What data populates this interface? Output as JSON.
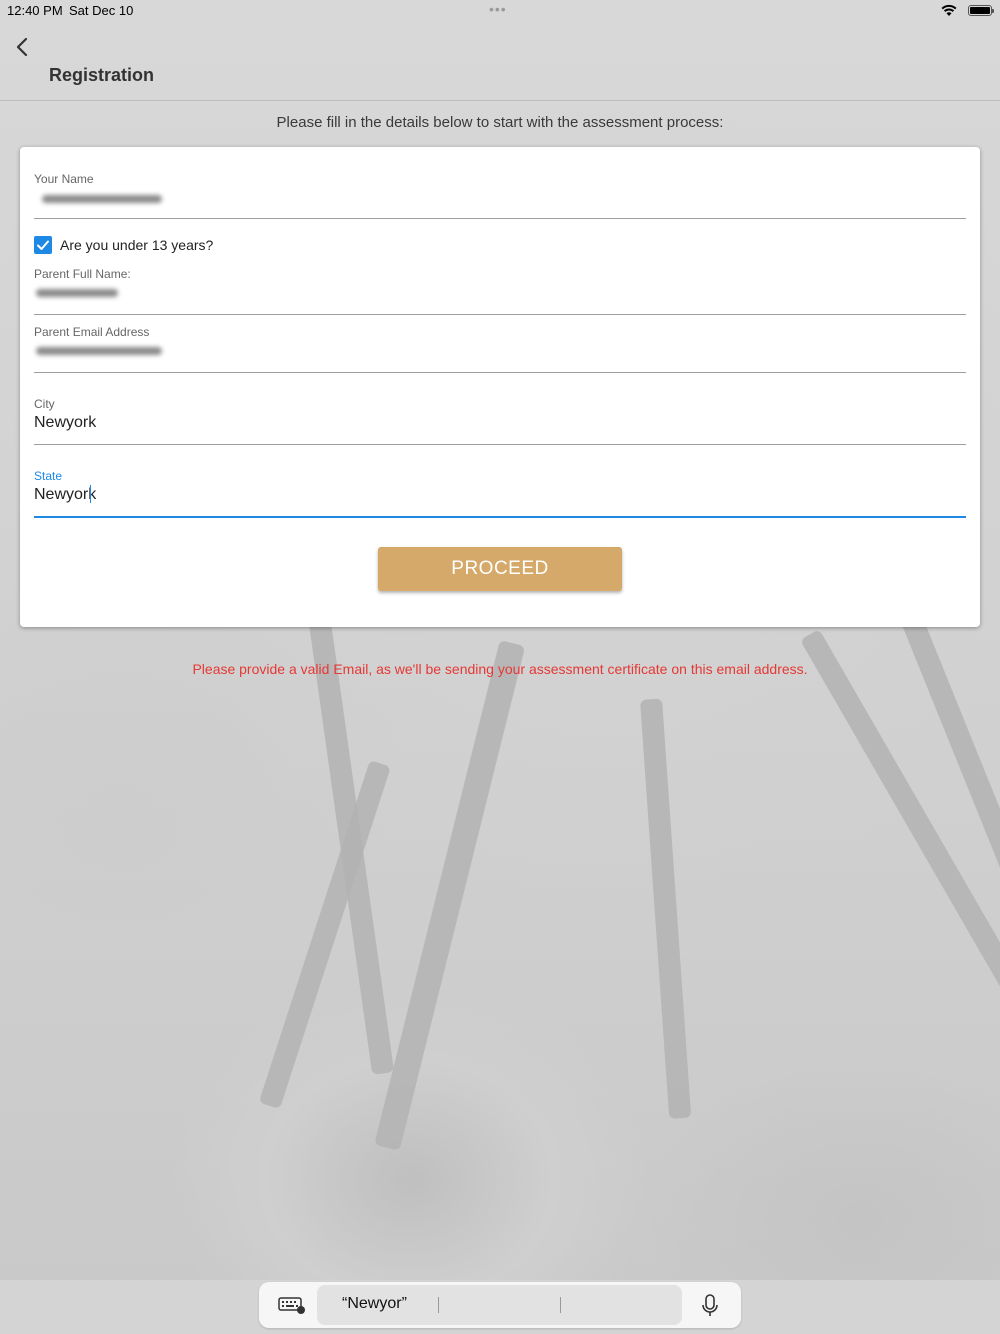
{
  "status_bar": {
    "time": "12:40 PM",
    "date": "Sat Dec 10",
    "dots": "•••",
    "icons": [
      "wifi-icon",
      "battery-icon"
    ]
  },
  "header": {
    "back_icon": "chevron-left-icon",
    "title": "Registration"
  },
  "instructions": "Please fill in the details below to start with the assessment process:",
  "form": {
    "your_name": {
      "label": "Your Name"
    },
    "under_13": {
      "label": "Are you under 13 years?",
      "checked": true
    },
    "parent_full_name": {
      "label": "Parent Full Name:"
    },
    "parent_email": {
      "label": "Parent Email Address"
    },
    "city": {
      "label": "City",
      "value": "Newyork"
    },
    "state": {
      "label": "State",
      "value": "Newyork",
      "focused": true
    },
    "proceed_label": "PROCEED"
  },
  "warning": "Please provide a valid Email, as we'll be sending your assessment certificate on this email address.",
  "keyboard_bar": {
    "keyboard_icon": "keyboard-icon",
    "suggestion": "“Newyor”",
    "mic_icon": "microphone-icon"
  },
  "colors": {
    "accent": "#1e88e5",
    "button": "#d4a96a",
    "warning": "#e53935"
  }
}
